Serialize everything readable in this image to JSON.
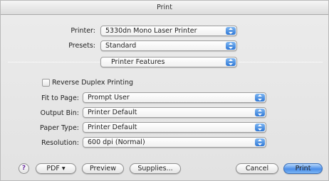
{
  "title": "Print",
  "printer": {
    "label": "Printer:",
    "value": "5330dn Mono Laser Printer"
  },
  "presets": {
    "label": "Presets:",
    "value": "Standard"
  },
  "panel": {
    "value": "Printer Features"
  },
  "reverse_duplex": {
    "label": "Reverse Duplex Printing",
    "checked": false
  },
  "fit_to_page": {
    "label": "Fit to Page:",
    "value": "Prompt User"
  },
  "output_bin": {
    "label": "Output Bin:",
    "value": "Printer Default"
  },
  "paper_type": {
    "label": "Paper Type:",
    "value": "Printer Default"
  },
  "resolution": {
    "label": "Resolution:",
    "value": "600 dpi (Normal)"
  },
  "buttons": {
    "help": "?",
    "pdf": "PDF ▾",
    "preview": "Preview",
    "supplies": "Supplies...",
    "cancel": "Cancel",
    "print": "Print"
  },
  "colors": {
    "accent": "#2f78d6",
    "primary_button": "#4c8ee8"
  }
}
